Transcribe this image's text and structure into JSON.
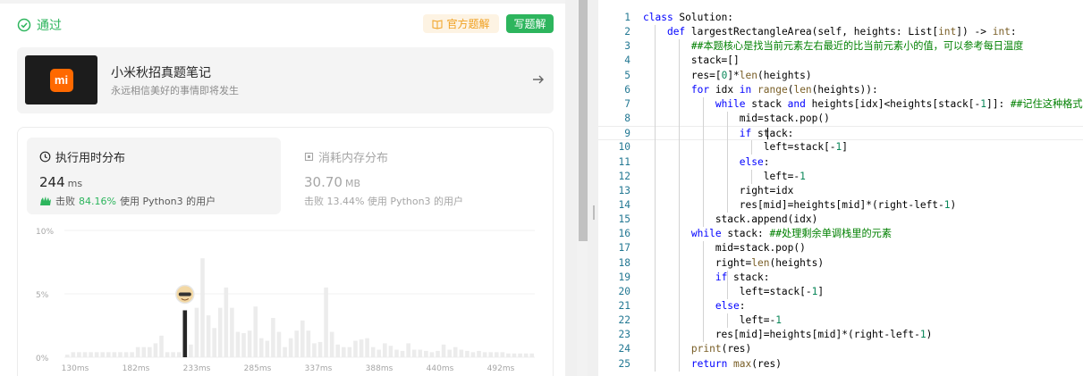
{
  "status": {
    "text": "通过",
    "color": "#2db55d"
  },
  "buttons": {
    "official": "官方题解",
    "write": "写题解"
  },
  "banner": {
    "title": "小米秋招真题笔记",
    "subtitle": "永远相信美好的事情即将发生",
    "logo_text": "mi"
  },
  "runtime": {
    "title": "执行用时分布",
    "value": "244",
    "unit": "ms",
    "beat_prefix": "击败",
    "beat_pct": "84.16%",
    "beat_suffix": "使用 Python3 的用户"
  },
  "memory": {
    "title": "消耗内存分布",
    "value": "30.70",
    "unit": "MB",
    "beat_text": "击败 13.44% 使用 Python3 的用户"
  },
  "chart_data": {
    "type": "bar",
    "y_ticks": [
      "10%",
      "5%",
      "0%"
    ],
    "ylim": [
      0,
      10
    ],
    "x_ticks": [
      "130ms",
      "182ms",
      "233ms",
      "285ms",
      "337ms",
      "388ms",
      "440ms",
      "492ms"
    ],
    "highlight_index": 20,
    "values": [
      0.2,
      0.4,
      0.4,
      0.4,
      0.4,
      0.4,
      0.4,
      0.4,
      0.4,
      0.4,
      0.4,
      0.4,
      0.8,
      0.8,
      0.8,
      1.1,
      1.7,
      0.4,
      0.4,
      0.4,
      3.7,
      1.0,
      3.9,
      7.8,
      3.3,
      2.3,
      3.9,
      5.5,
      3.9,
      2.0,
      1.9,
      2.1,
      4.0,
      1.5,
      1.3,
      3.1,
      2.0,
      0.8,
      1.5,
      2.1,
      2.9,
      2.1,
      1.1,
      1.2,
      5.5,
      2.0,
      1.0,
      0.8,
      0.8,
      1.3,
      1.4,
      1.5,
      0.8,
      0.6,
      1.1,
      0.9,
      0.6,
      0.5,
      1.1,
      0.6,
      0.6,
      0.5,
      0.4,
      0.5,
      1.0,
      0.6,
      0.8,
      0.6,
      0.5,
      0.4,
      0.5,
      0.4,
      0.4,
      0.4,
      0.4,
      0.3,
      0.3,
      0.3,
      0.3,
      0.3
    ]
  },
  "code_lines": [
    [
      [
        "kw",
        "class "
      ],
      [
        "t",
        "Solution:"
      ]
    ],
    [
      [
        "t",
        "    "
      ],
      [
        "kw",
        "def "
      ],
      [
        "t",
        "largestRectangleArea(self, heights: List["
      ],
      [
        "bi",
        "int"
      ],
      [
        "t",
        "]) -> "
      ],
      [
        "bi",
        "int"
      ],
      [
        "t",
        ":"
      ]
    ],
    [
      [
        "t",
        "        "
      ],
      [
        "cm",
        "##本题核心是找当前元素左右最近的比当前元素小的值，可以参考每日温度"
      ]
    ],
    [
      [
        "t",
        "        stack=[]"
      ]
    ],
    [
      [
        "t",
        "        res=["
      ],
      [
        "num",
        "0"
      ],
      [
        "t",
        "]*"
      ],
      [
        "bi",
        "len"
      ],
      [
        "t",
        "(heights)"
      ]
    ],
    [
      [
        "t",
        "        "
      ],
      [
        "kw",
        "for "
      ],
      [
        "t",
        "idx "
      ],
      [
        "kw",
        "in "
      ],
      [
        "bi",
        "range"
      ],
      [
        "t",
        "("
      ],
      [
        "bi",
        "len"
      ],
      [
        "t",
        "(heights)):"
      ]
    ],
    [
      [
        "t",
        "            "
      ],
      [
        "kw",
        "while "
      ],
      [
        "t",
        "stack "
      ],
      [
        "kw",
        "and "
      ],
      [
        "t",
        "heights[idx]<heights[stack[-"
      ],
      [
        "num",
        "1"
      ],
      [
        "t",
        "]]: "
      ],
      [
        "cm",
        "##记住这种格式"
      ]
    ],
    [
      [
        "t",
        "                mid=stack.pop()"
      ]
    ],
    [
      [
        "t",
        "                "
      ],
      [
        "kw",
        "if "
      ],
      [
        "t",
        "stack:"
      ]
    ],
    [
      [
        "t",
        "                    left=stack[-"
      ],
      [
        "num",
        "1"
      ],
      [
        "t",
        "]"
      ]
    ],
    [
      [
        "t",
        "                "
      ],
      [
        "kw",
        "else"
      ],
      [
        "t",
        ":"
      ]
    ],
    [
      [
        "t",
        "                    left=-"
      ],
      [
        "num",
        "1"
      ]
    ],
    [
      [
        "t",
        "                right=idx"
      ]
    ],
    [
      [
        "t",
        "                res[mid]=heights[mid]*(right-left-"
      ],
      [
        "num",
        "1"
      ],
      [
        "t",
        ")"
      ]
    ],
    [
      [
        "t",
        "            stack.append(idx)"
      ]
    ],
    [
      [
        "t",
        "        "
      ],
      [
        "kw",
        "while "
      ],
      [
        "t",
        "stack: "
      ],
      [
        "cm",
        "##处理剩余单调栈里的元素"
      ]
    ],
    [
      [
        "t",
        "            mid=stack.pop()"
      ]
    ],
    [
      [
        "t",
        "            right="
      ],
      [
        "bi",
        "len"
      ],
      [
        "t",
        "(heights)"
      ]
    ],
    [
      [
        "t",
        "            "
      ],
      [
        "kw",
        "if "
      ],
      [
        "t",
        "stack:"
      ]
    ],
    [
      [
        "t",
        "                left=stack[-"
      ],
      [
        "num",
        "1"
      ],
      [
        "t",
        "]"
      ]
    ],
    [
      [
        "t",
        "            "
      ],
      [
        "kw",
        "else"
      ],
      [
        "t",
        ":"
      ]
    ],
    [
      [
        "t",
        "                left=-"
      ],
      [
        "num",
        "1"
      ]
    ],
    [
      [
        "t",
        "            res[mid]=heights[mid]*(right-left-"
      ],
      [
        "num",
        "1"
      ],
      [
        "t",
        ")"
      ]
    ],
    [
      [
        "t",
        "        "
      ],
      [
        "bi",
        "print"
      ],
      [
        "t",
        "(res)"
      ]
    ],
    [
      [
        "t",
        "        "
      ],
      [
        "kw",
        "return "
      ],
      [
        "bi",
        "max"
      ],
      [
        "t",
        "(res)"
      ]
    ]
  ],
  "active_line": 9,
  "colors": {
    "accent": "#2db55d",
    "keyword": "#0000ff",
    "builtin": "#795e26",
    "comment": "#008000",
    "number": "#098658",
    "line_number": "#237893"
  },
  "icons": {
    "status": "check-circle-icon",
    "official": "book-icon",
    "banner_arrow": "arrow-right-icon",
    "runtime": "clock-icon",
    "memory": "chip-icon",
    "beat": "hands-icon",
    "avatar": "avatar-icon"
  }
}
